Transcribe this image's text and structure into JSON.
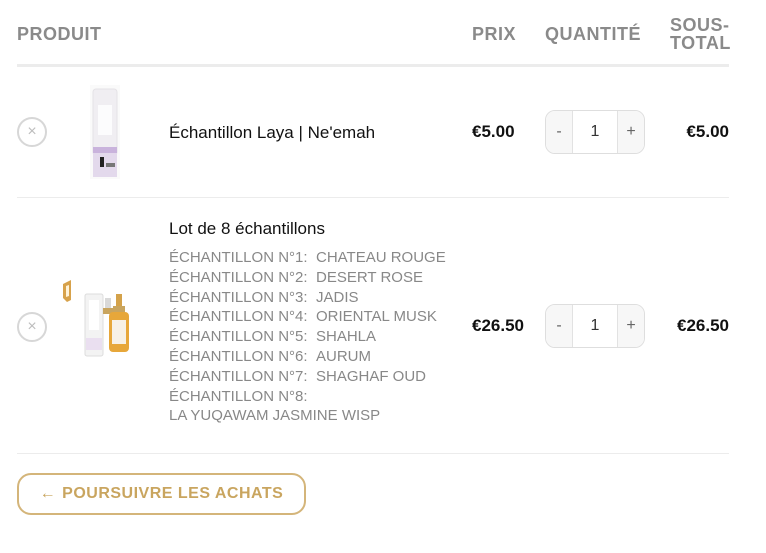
{
  "table": {
    "headers": {
      "product": "PRODUIT",
      "price": "PRIX",
      "quantity": "QUANTITÉ",
      "subtotal_line1": "SOUS-",
      "subtotal_line2": "TOTAL"
    },
    "rows": [
      {
        "remove_symbol": "×",
        "name": "Échantillon Laya | Ne'emah",
        "thumbnail_icon": "perfume-sample-image",
        "price": "€5.00",
        "qty_minus": "-",
        "qty_value": "1",
        "qty_plus": "+",
        "subtotal": "€5.00"
      },
      {
        "remove_symbol": "×",
        "name": "Lot de 8 échantillons",
        "thumbnail_icon": "sample-set-image",
        "variations": [
          {
            "key": "ÉCHANTILLON N°1:",
            "value": "CHATEAU ROUGE"
          },
          {
            "key": "ÉCHANTILLON N°2:",
            "value": "DESERT ROSE"
          },
          {
            "key": "ÉCHANTILLON N°3:",
            "value": "JADIS"
          },
          {
            "key": "ÉCHANTILLON N°4:",
            "value": "ORIENTAL MUSK"
          },
          {
            "key": "ÉCHANTILLON N°5:",
            "value": "SHAHLA"
          },
          {
            "key": "ÉCHANTILLON N°6:",
            "value": "AURUM"
          },
          {
            "key": "ÉCHANTILLON N°7:",
            "value": "SHAGHAF OUD"
          },
          {
            "key": "ÉCHANTILLON N°8:",
            "value": ""
          }
        ],
        "variation_tail": "LA YUQAWAM JASMINE WISP",
        "price": "€26.50",
        "qty_minus": "-",
        "qty_value": "1",
        "qty_plus": "+",
        "subtotal": "€26.50"
      }
    ]
  },
  "continue_button": {
    "arrow": "←",
    "label": "POURSUIVRE LES ACHATS"
  },
  "colors": {
    "accent_gold": "#c9a55f",
    "header_text": "#8a8a8a",
    "divider": "#ececec"
  }
}
